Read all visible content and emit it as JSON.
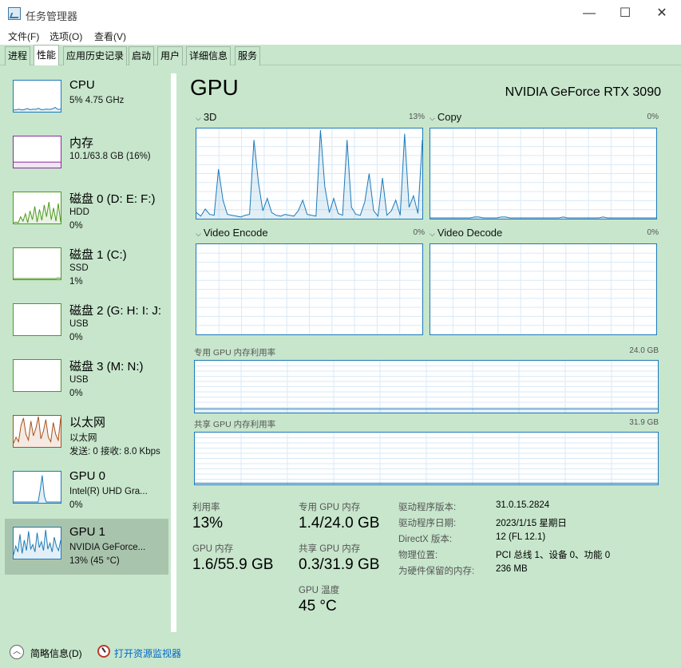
{
  "window": {
    "title": "任务管理器",
    "min": "—",
    "max": "☐",
    "close": "✕"
  },
  "menu": [
    "文件(F)",
    "选项(O)",
    "查看(V)"
  ],
  "tabs": [
    "进程",
    "性能",
    "应用历史记录",
    "启动",
    "用户",
    "详细信息",
    "服务"
  ],
  "active_tab": "性能",
  "sidebar": [
    {
      "title": "CPU",
      "line1": "5% 4.75 GHz",
      "line2": "",
      "color": "#1c7ab8"
    },
    {
      "title": "内存",
      "line1": "10.1/63.8 GB (16%)",
      "line2": "",
      "color": "#8b2a9e"
    },
    {
      "title": "磁盘 0 (D: E: F:)",
      "line1": "HDD",
      "line2": "0%",
      "color": "#4d9a1f"
    },
    {
      "title": "磁盘 1 (C:)",
      "line1": "SSD",
      "line2": "1%",
      "color": "#4d9a1f"
    },
    {
      "title": "磁盘 2 (G: H: I: J:",
      "line1": "USB",
      "line2": "0%",
      "color": "#4d9a1f"
    },
    {
      "title": "磁盘 3 (M: N:)",
      "line1": "USB",
      "line2": "0%",
      "color": "#4d9a1f"
    },
    {
      "title": "以太网",
      "line1": "以太网",
      "line2": "发送: 0 接收: 8.0 Kbps",
      "color": "#a7521c"
    },
    {
      "title": "GPU 0",
      "line1": "Intel(R) UHD Gra...",
      "line2": "0%",
      "color": "#1c7ab8"
    },
    {
      "title": "GPU 1",
      "line1": "NVIDIA GeForce...",
      "line2": "13% (45 °C)",
      "color": "#1c7ab8"
    }
  ],
  "selected_item": "GPU 1",
  "main": {
    "title": "GPU",
    "gpu_name": "NVIDIA GeForce RTX 3090",
    "engines": [
      {
        "name": "3D",
        "pct": "13%"
      },
      {
        "name": "Copy",
        "pct": "0%"
      },
      {
        "name": "Video Encode",
        "pct": "0%"
      },
      {
        "name": "Video Decode",
        "pct": "0%"
      }
    ],
    "dedicated_label": "专用 GPU 内存利用率",
    "dedicated_max": "24.0 GB",
    "shared_label": "共享 GPU 内存利用率",
    "shared_max": "31.9 GB"
  },
  "stats": {
    "util_label": "利用率",
    "util_value": "13%",
    "gpu_mem_label": "GPU 内存",
    "gpu_mem_value": "1.6/55.9 GB",
    "ded_mem_label": "专用 GPU 内存",
    "ded_mem_value": "1.4/24.0 GB",
    "shr_mem_label": "共享 GPU 内存",
    "shr_mem_value": "0.3/31.9 GB",
    "temp_label": "GPU 温度",
    "temp_value": "45 °C"
  },
  "info": [
    {
      "key": "驱动程序版本:",
      "value": "31.0.15.2824"
    },
    {
      "key": "驱动程序日期:",
      "value": "2023/1/15 星期日"
    },
    {
      "key": "DirectX 版本:",
      "value": "12 (FL 12.1)"
    },
    {
      "key": "物理位置:",
      "value": "PCI 总线 1、设备 0、功能 0"
    },
    {
      "key": "为硬件保留的内存:",
      "value": "236 MB"
    }
  ],
  "footer": {
    "fewer": "简略信息(D)",
    "resmon": "打开资源监视器"
  },
  "colors": {
    "background": "#c7e6cc",
    "selected": "#a9c4ad",
    "graph_line": "#1c7ab8"
  },
  "graph_series": {
    "gpu_3d": [
      6,
      2,
      10,
      4,
      3,
      55,
      20,
      4,
      3,
      2,
      1,
      3,
      4,
      88,
      40,
      8,
      22,
      6,
      3,
      2,
      4,
      3,
      2,
      8,
      20,
      4,
      3,
      2,
      99,
      35,
      6,
      22,
      5,
      3,
      88,
      12,
      4,
      3,
      18,
      50,
      8,
      2,
      45,
      3,
      8,
      20,
      3,
      95,
      12,
      25,
      5,
      88
    ],
    "copy": [
      0,
      0,
      0,
      0,
      0,
      0,
      0,
      0,
      0,
      0,
      1,
      1,
      0,
      0,
      0,
      0,
      1,
      1,
      0,
      0,
      0,
      0,
      0,
      0,
      0,
      0,
      0,
      0,
      0,
      0,
      1,
      0,
      0,
      0,
      0,
      0,
      0,
      0,
      0,
      1,
      0,
      0,
      0,
      0,
      0,
      0,
      0,
      0,
      0,
      0,
      0,
      0
    ],
    "dedicated_mem": [
      5.8,
      5.8,
      5.8,
      5.8,
      5.8,
      5.8,
      5.8,
      5.8,
      5.8,
      5.8,
      5.8,
      5.8,
      5.8,
      5.8,
      5.8,
      5.8,
      5.8,
      5.8,
      5.8,
      5.8,
      5.8,
      5.8,
      5.8,
      5.8,
      5.8,
      5.8,
      5.8,
      5.8,
      5.8,
      5.8,
      5.8,
      5.8
    ],
    "shared_mem": [
      0.9,
      0.9,
      0.9,
      0.9,
      0.9,
      0.9,
      0.9,
      0.9,
      0.9,
      0.9,
      0.9,
      0.9,
      0.9,
      0.9,
      0.9,
      0.9,
      0.9,
      0.9,
      0.9,
      0.9,
      0.9,
      0.9,
      0.9,
      0.9,
      0.9,
      0.9,
      0.9,
      0.9,
      0.9,
      0.9,
      0.9,
      0.9
    ],
    "thumb_cpu": [
      3,
      4,
      6,
      3,
      5,
      8,
      4,
      6,
      5,
      9,
      4,
      5,
      6,
      5,
      7,
      12,
      5,
      6
    ],
    "thumb_mem": [
      16,
      16,
      16,
      16,
      16,
      16,
      16,
      16,
      16,
      16,
      16,
      16,
      16,
      16,
      16,
      16,
      16,
      16
    ],
    "thumb_disk0": [
      0,
      2,
      0,
      20,
      5,
      30,
      0,
      40,
      10,
      55,
      2,
      45,
      8,
      60,
      20,
      70,
      10,
      50,
      5,
      65,
      2
    ],
    "thumb_disk1": [
      0,
      0,
      0,
      0,
      0,
      0,
      0,
      0,
      0,
      0,
      0,
      0,
      0,
      0,
      0,
      0,
      0,
      0,
      2,
      1
    ],
    "thumb_eth": [
      10,
      30,
      15,
      70,
      95,
      40,
      20,
      85,
      35,
      60,
      100,
      25,
      50,
      90,
      30,
      15,
      80,
      40,
      20,
      95
    ],
    "thumb_gpu0": [
      0,
      0,
      0,
      0,
      0,
      0,
      0,
      0,
      0,
      0,
      0,
      0,
      0,
      40,
      90,
      20,
      0,
      0,
      0,
      0,
      0,
      0,
      0,
      0
    ],
    "thumb_gpu1": [
      10,
      40,
      20,
      80,
      15,
      60,
      25,
      90,
      30,
      45,
      20,
      85,
      35,
      55,
      25,
      95,
      30,
      50,
      20,
      70,
      40,
      25,
      60
    ]
  }
}
